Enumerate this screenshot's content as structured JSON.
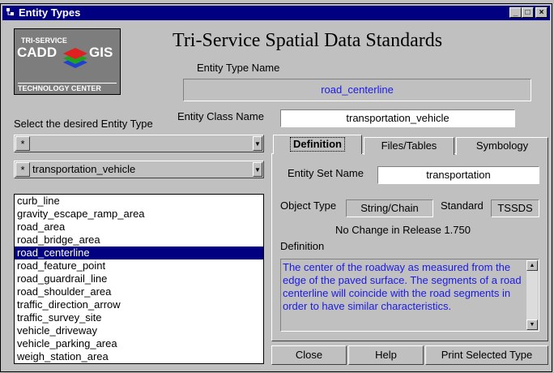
{
  "window": {
    "title": "Entity Types"
  },
  "background_strip_text": "...... ..... .....",
  "logo": {
    "line1": "TRI-SERVICE",
    "word_left": "CADD",
    "word_right": "GIS",
    "bottom": "TECHNOLOGY CENTER"
  },
  "header": {
    "title": "Tri-Service Spatial Data Standards"
  },
  "entity_type": {
    "label": "Entity Type Name",
    "value": "road_centerline"
  },
  "entity_class": {
    "label": "Entity Class Name",
    "value": "transportation_vehicle"
  },
  "selector": {
    "prompt": "Select the desired Entity Type",
    "combo1": {
      "star": "*",
      "value": ""
    },
    "combo2": {
      "star": "*",
      "value": "transportation_vehicle"
    }
  },
  "entity_list": [
    "curb_line",
    "gravity_escape_ramp_area",
    "road_area",
    "road_bridge_area",
    "road_centerline",
    "road_feature_point",
    "road_guardrail_line",
    "road_shoulder_area",
    "traffic_direction_arrow",
    "traffic_survey_site",
    "vehicle_driveway",
    "vehicle_parking_area",
    "weigh_station_area"
  ],
  "selected_item": "road_centerline",
  "tabs": {
    "definition": "Definition",
    "files": "Files/Tables",
    "symbology": "Symbology"
  },
  "definition_panel": {
    "entity_set_label": "Entity Set Name",
    "entity_set_value": "transportation",
    "object_type_label": "Object Type",
    "object_type_value": "String/Chain",
    "standard_label": "Standard",
    "standard_value": "TSSDS",
    "release_note": "No Change in Release 1.750",
    "definition_label": "Definition",
    "definition_text": "The center of the roadway as measured from the edge of the paved surface. The segments of a road centerline will coincide with the road segments in order to have similar characteristics."
  },
  "buttons": {
    "close": "Close",
    "help": "Help",
    "print": "Print Selected Type"
  },
  "colors": {
    "title_bar": "#000080",
    "selection": "#000080",
    "definition_text": "#1a1ae6",
    "entity_type_value": "#1a1ae6",
    "face": "#c0c0c0"
  }
}
